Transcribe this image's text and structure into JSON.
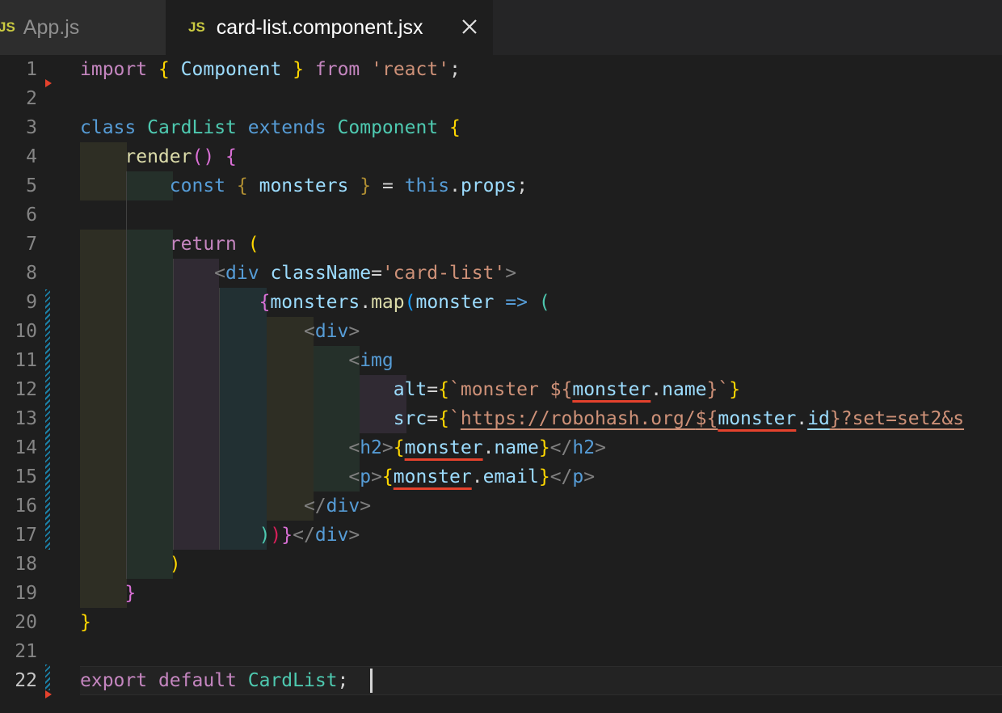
{
  "tabs": [
    {
      "badge": "JS",
      "label": "App.js",
      "active": false
    },
    {
      "badge": "JS",
      "label": "card-list.component.jsx",
      "active": true
    }
  ],
  "line_numbers": [
    "1",
    "2",
    "3",
    "4",
    "5",
    "6",
    "7",
    "8",
    "9",
    "10",
    "11",
    "12",
    "13",
    "14",
    "15",
    "16",
    "17",
    "18",
    "19",
    "20",
    "21",
    "22"
  ],
  "code": {
    "l1": {
      "import": "import",
      "ob": "{",
      "comp": "Component",
      "cb": "}",
      "from": "from",
      "str": "'react'",
      "semi": ";"
    },
    "l3": {
      "class": "class",
      "name": "CardList",
      "extends": "extends",
      "base": "Component",
      "ob": "{"
    },
    "l4": {
      "fn": "render",
      "paren": "()",
      "ob": "{"
    },
    "l5": {
      "const": "const",
      "ob": "{",
      "var": "monsters",
      "cb": "}",
      "eq": "=",
      "this": "this",
      "dot": ".",
      "props": "props",
      "semi": ";"
    },
    "l7": {
      "return": "return",
      "paren": "("
    },
    "l8": {
      "lt": "<",
      "tag": "div",
      "attr": "className",
      "eq": "=",
      "str": "'card-list'",
      "gt": ">"
    },
    "l9": {
      "ob": "{",
      "var": "monsters",
      "dot": ".",
      "fn": "map",
      "p": "(",
      "param": "monster",
      "arrow": "=>",
      "p2": "("
    },
    "l10": {
      "lt": "<",
      "tag": "div",
      "gt": ">"
    },
    "l11": {
      "lt": "<",
      "tag": "img"
    },
    "l12": {
      "attr": "alt",
      "eq": "=",
      "ob": "{",
      "tick": "`",
      "str": "monster ",
      "ds": "${",
      "var": "monster",
      "dot": ".",
      "prop": "name",
      "cb": "}",
      "tick2": "`",
      "cb2": "}"
    },
    "l13": {
      "attr": "src",
      "eq": "=",
      "ob": "{",
      "tick": "`",
      "url": "https://robohash.org/",
      "ds": "${",
      "var": "monster",
      "dot": ".",
      "prop": "id",
      "cb": "}",
      "tail": "?set=set2&s"
    },
    "l14": {
      "open": "<",
      "tag": "h2",
      "gt": ">",
      "ob": "{",
      "var": "monster",
      "dot": ".",
      "prop": "name",
      "cb": "}",
      "close": "</",
      "tag2": "h2",
      "gt2": ">"
    },
    "l15": {
      "open": "<",
      "tag": "p",
      "gt": ">",
      "ob": "{",
      "var": "monster",
      "dot": ".",
      "prop": "email",
      "cb": "}",
      "close": "</",
      "tag2": "p",
      "gt2": ">"
    },
    "l16": {
      "close": "</",
      "tag": "div",
      "gt": ">"
    },
    "l17": {
      "p1": ")",
      "p2": ")",
      "cb": "}",
      "close": "</",
      "tag": "div",
      "gt": ">"
    },
    "l18": {
      "paren": ")"
    },
    "l19": {
      "cb": "}"
    },
    "l20": {
      "cb": "}"
    },
    "l22": {
      "export": "export",
      "default": "default",
      "name": "CardList",
      "semi": ";"
    }
  }
}
